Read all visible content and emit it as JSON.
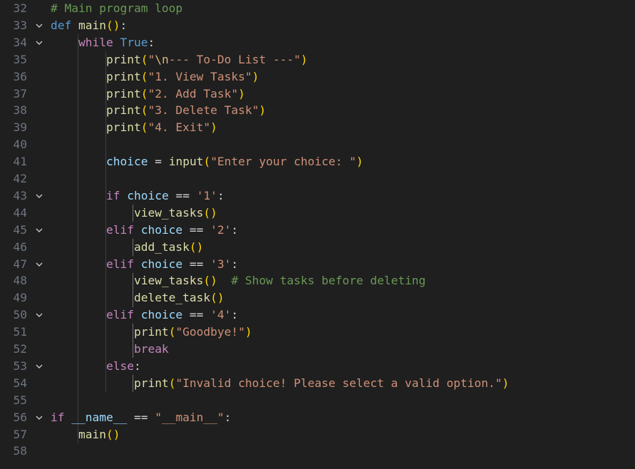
{
  "editor": {
    "lines": [
      {
        "num": "32",
        "fold": false,
        "indent": "",
        "tokens": [
          {
            "t": "# Main program loop",
            "c": "cmt"
          }
        ]
      },
      {
        "num": "33",
        "fold": true,
        "indent": "",
        "tokens": [
          {
            "t": "def",
            "c": "kw"
          },
          {
            "t": " ",
            "c": "pl"
          },
          {
            "t": "main",
            "c": "fn"
          },
          {
            "t": "()",
            "c": "p1"
          },
          {
            "t": ":",
            "c": "pl"
          }
        ]
      },
      {
        "num": "34",
        "fold": true,
        "indent": "    ",
        "tokens": [
          {
            "t": "while",
            "c": "ctl"
          },
          {
            "t": " ",
            "c": "pl"
          },
          {
            "t": "True",
            "c": "kw"
          },
          {
            "t": ":",
            "c": "pl"
          }
        ]
      },
      {
        "num": "35",
        "fold": false,
        "indent": "        ",
        "tokens": [
          {
            "t": "print",
            "c": "fn"
          },
          {
            "t": "(",
            "c": "p1"
          },
          {
            "t": "\"",
            "c": "str"
          },
          {
            "t": "\\n",
            "c": "esc"
          },
          {
            "t": "--- To-Do List ---\"",
            "c": "str"
          },
          {
            "t": ")",
            "c": "p1"
          }
        ]
      },
      {
        "num": "36",
        "fold": false,
        "indent": "        ",
        "tokens": [
          {
            "t": "print",
            "c": "fn"
          },
          {
            "t": "(",
            "c": "p1"
          },
          {
            "t": "\"1. View Tasks\"",
            "c": "str"
          },
          {
            "t": ")",
            "c": "p1"
          }
        ]
      },
      {
        "num": "37",
        "fold": false,
        "indent": "        ",
        "tokens": [
          {
            "t": "print",
            "c": "fn"
          },
          {
            "t": "(",
            "c": "p1"
          },
          {
            "t": "\"2. Add Task\"",
            "c": "str"
          },
          {
            "t": ")",
            "c": "p1"
          }
        ]
      },
      {
        "num": "38",
        "fold": false,
        "indent": "        ",
        "tokens": [
          {
            "t": "print",
            "c": "fn"
          },
          {
            "t": "(",
            "c": "p1"
          },
          {
            "t": "\"3. Delete Task\"",
            "c": "str"
          },
          {
            "t": ")",
            "c": "p1"
          }
        ]
      },
      {
        "num": "39",
        "fold": false,
        "indent": "        ",
        "tokens": [
          {
            "t": "print",
            "c": "fn"
          },
          {
            "t": "(",
            "c": "p1"
          },
          {
            "t": "\"4. Exit\"",
            "c": "str"
          },
          {
            "t": ")",
            "c": "p1"
          }
        ]
      },
      {
        "num": "40",
        "fold": false,
        "indent": "",
        "tokens": []
      },
      {
        "num": "41",
        "fold": false,
        "indent": "        ",
        "tokens": [
          {
            "t": "choice",
            "c": "var"
          },
          {
            "t": " = ",
            "c": "op"
          },
          {
            "t": "input",
            "c": "fn"
          },
          {
            "t": "(",
            "c": "p1"
          },
          {
            "t": "\"Enter your choice: \"",
            "c": "str"
          },
          {
            "t": ")",
            "c": "p1"
          }
        ]
      },
      {
        "num": "42",
        "fold": false,
        "indent": "",
        "tokens": []
      },
      {
        "num": "43",
        "fold": true,
        "indent": "        ",
        "tokens": [
          {
            "t": "if",
            "c": "ctl"
          },
          {
            "t": " ",
            "c": "pl"
          },
          {
            "t": "choice",
            "c": "var"
          },
          {
            "t": " == ",
            "c": "op"
          },
          {
            "t": "'1'",
            "c": "str"
          },
          {
            "t": ":",
            "c": "pl"
          }
        ]
      },
      {
        "num": "44",
        "fold": false,
        "indent": "            ",
        "tokens": [
          {
            "t": "view_tasks",
            "c": "fn"
          },
          {
            "t": "()",
            "c": "p1"
          }
        ]
      },
      {
        "num": "45",
        "fold": true,
        "indent": "        ",
        "tokens": [
          {
            "t": "elif",
            "c": "ctl"
          },
          {
            "t": " ",
            "c": "pl"
          },
          {
            "t": "choice",
            "c": "var"
          },
          {
            "t": " == ",
            "c": "op"
          },
          {
            "t": "'2'",
            "c": "str"
          },
          {
            "t": ":",
            "c": "pl"
          }
        ]
      },
      {
        "num": "46",
        "fold": false,
        "indent": "            ",
        "tokens": [
          {
            "t": "add_task",
            "c": "fn"
          },
          {
            "t": "()",
            "c": "p1"
          }
        ]
      },
      {
        "num": "47",
        "fold": true,
        "indent": "        ",
        "tokens": [
          {
            "t": "elif",
            "c": "ctl"
          },
          {
            "t": " ",
            "c": "pl"
          },
          {
            "t": "choice",
            "c": "var"
          },
          {
            "t": " == ",
            "c": "op"
          },
          {
            "t": "'3'",
            "c": "str"
          },
          {
            "t": ":",
            "c": "pl"
          }
        ]
      },
      {
        "num": "48",
        "fold": false,
        "indent": "            ",
        "tokens": [
          {
            "t": "view_tasks",
            "c": "fn"
          },
          {
            "t": "()",
            "c": "p1"
          },
          {
            "t": "  ",
            "c": "pl"
          },
          {
            "t": "# Show tasks before deleting",
            "c": "cmt"
          }
        ]
      },
      {
        "num": "49",
        "fold": false,
        "indent": "            ",
        "tokens": [
          {
            "t": "delete_task",
            "c": "fn"
          },
          {
            "t": "()",
            "c": "p1"
          }
        ]
      },
      {
        "num": "50",
        "fold": true,
        "indent": "        ",
        "tokens": [
          {
            "t": "elif",
            "c": "ctl"
          },
          {
            "t": " ",
            "c": "pl"
          },
          {
            "t": "choice",
            "c": "var"
          },
          {
            "t": " == ",
            "c": "op"
          },
          {
            "t": "'4'",
            "c": "str"
          },
          {
            "t": ":",
            "c": "pl"
          }
        ]
      },
      {
        "num": "51",
        "fold": false,
        "indent": "            ",
        "tokens": [
          {
            "t": "print",
            "c": "fn"
          },
          {
            "t": "(",
            "c": "p1"
          },
          {
            "t": "\"Goodbye!\"",
            "c": "str"
          },
          {
            "t": ")",
            "c": "p1"
          }
        ]
      },
      {
        "num": "52",
        "fold": false,
        "indent": "            ",
        "tokens": [
          {
            "t": "break",
            "c": "ctl"
          }
        ]
      },
      {
        "num": "53",
        "fold": true,
        "indent": "        ",
        "tokens": [
          {
            "t": "else",
            "c": "ctl"
          },
          {
            "t": ":",
            "c": "pl"
          }
        ]
      },
      {
        "num": "54",
        "fold": false,
        "indent": "            ",
        "tokens": [
          {
            "t": "print",
            "c": "fn"
          },
          {
            "t": "(",
            "c": "p1"
          },
          {
            "t": "\"Invalid choice! Please select a valid option.\"",
            "c": "str"
          },
          {
            "t": ")",
            "c": "p1"
          }
        ]
      },
      {
        "num": "55",
        "fold": false,
        "indent": "",
        "tokens": []
      },
      {
        "num": "56",
        "fold": true,
        "indent": "",
        "tokens": [
          {
            "t": "if",
            "c": "ctl"
          },
          {
            "t": " ",
            "c": "pl"
          },
          {
            "t": "__name__",
            "c": "var"
          },
          {
            "t": " == ",
            "c": "op"
          },
          {
            "t": "\"__main__\"",
            "c": "str"
          },
          {
            "t": ":",
            "c": "pl"
          }
        ]
      },
      {
        "num": "57",
        "fold": false,
        "indent": "    ",
        "tokens": [
          {
            "t": "main",
            "c": "fn"
          },
          {
            "t": "()",
            "c": "p1"
          }
        ]
      },
      {
        "num": "58",
        "fold": false,
        "indent": "",
        "tokens": []
      }
    ],
    "fold_icon": "chevron-down-icon",
    "colors": {
      "background": "#1f1f1f",
      "line_number": "#6e7681",
      "keyword": "#569cd6",
      "control": "#c586c0",
      "function": "#dcdcaa",
      "string": "#ce9178",
      "variable": "#9cdcfe",
      "comment": "#6a9955",
      "bracket": "#ffd700"
    }
  }
}
